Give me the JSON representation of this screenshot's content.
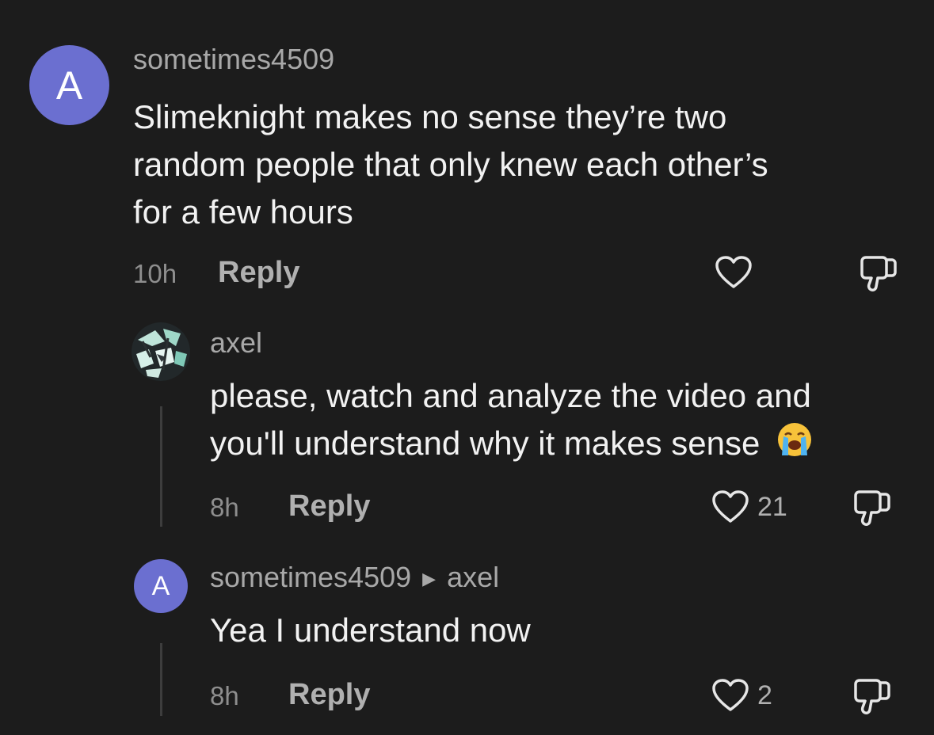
{
  "comments": [
    {
      "avatar_letter": "A",
      "username": "sometimes4509",
      "text_lines": [
        "Slimeknight makes no sense they’re two",
        "random people that only knew each other’s",
        "for a few hours"
      ],
      "time": "10h",
      "reply_label": "Reply",
      "like_count": ""
    },
    {
      "avatar": "abstract-avatar",
      "username": "axel",
      "text_lines": [
        "please, watch and analyze the video and",
        "you'll understand why it makes sense"
      ],
      "emoji": "loudly-crying-face-emoji",
      "time": "8h",
      "reply_label": "Reply",
      "like_count": "21"
    },
    {
      "avatar_letter": "A",
      "username": "sometimes4509",
      "reply_to": "axel",
      "text_lines": [
        "Yea I understand now"
      ],
      "time": "8h",
      "reply_label": "Reply",
      "like_count": "2"
    }
  ],
  "colors": {
    "background": "#1c1c1c",
    "avatar_bg": "#6b6fd0",
    "text": "#f2f2f2",
    "muted": "#a8a8a8"
  },
  "icons": [
    "heart-icon",
    "dislike-icon",
    "play-arrow-icon"
  ]
}
